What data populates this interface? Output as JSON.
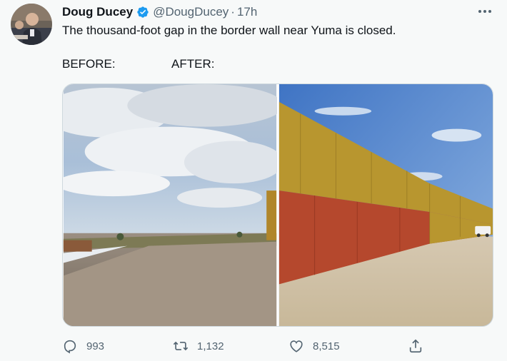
{
  "tweet": {
    "author_name": "Doug Ducey",
    "handle": "@DougDucey",
    "separator": "·",
    "timestamp": "17h",
    "text": "The thousand-foot gap in the border wall near Yuma is closed.",
    "label_before": "BEFORE:",
    "label_after": "AFTER:"
  },
  "icons": {
    "verified": "verified-badge-icon",
    "more": "more-options-icon",
    "reply": "reply-icon",
    "retweet": "retweet-icon",
    "like": "like-icon",
    "share": "share-icon"
  },
  "actions": {
    "reply_count": "993",
    "retweet_count": "1,132",
    "like_count": "8,515"
  },
  "colors": {
    "background": "#f7f9f9",
    "text_primary": "#0f1419",
    "text_secondary": "#536471",
    "verified": "#1d9bf0"
  }
}
